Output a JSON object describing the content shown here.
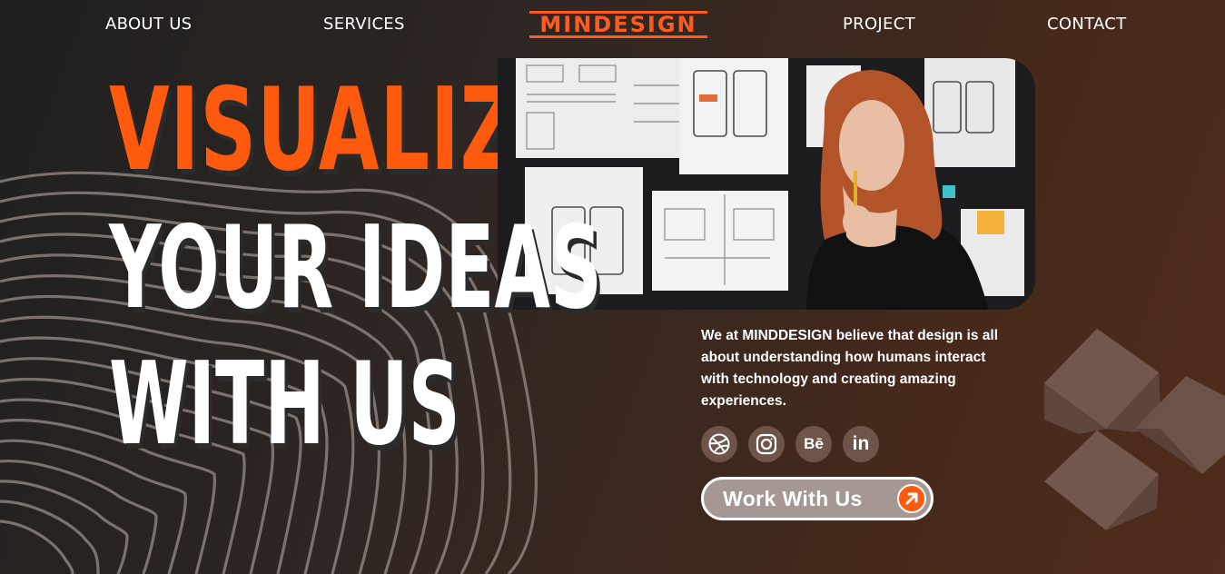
{
  "nav": {
    "about": "ABOUT US",
    "services": "SERVICES",
    "logo": "MINDESIGN",
    "project": "PROJECT",
    "contact": "CONTACT"
  },
  "hero": {
    "line1": "VISUALIZE",
    "line2": "YOUR IDEAS",
    "line3": "WITH US"
  },
  "description": "We at MINDDESIGN believe that design is all about understanding how humans interact with technology and creating amazing experiences.",
  "socials": [
    {
      "icon": "dribbble-icon"
    },
    {
      "icon": "instagram-icon"
    },
    {
      "icon": "behance-icon",
      "text": "Bē"
    },
    {
      "icon": "linkedin-icon",
      "text": "in"
    }
  ],
  "cta": {
    "label": "Work With Us",
    "icon": "arrow-up-right-icon"
  },
  "colors": {
    "accent": "#ff5a0d",
    "background_dark": "#1f1f1f",
    "background_brown": "#4f2c1d",
    "button_bg": "#a59893"
  }
}
